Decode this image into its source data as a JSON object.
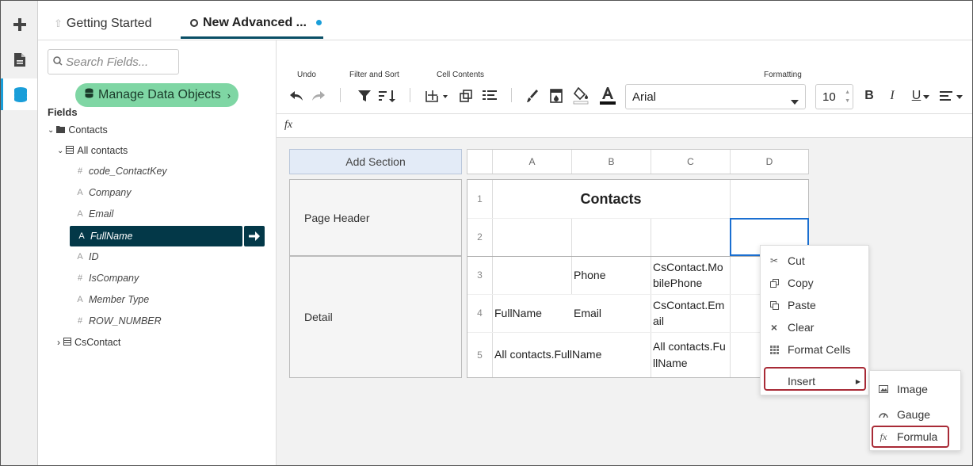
{
  "rail": {
    "icons": [
      "plus-icon",
      "document-icon",
      "database-icon"
    ]
  },
  "tabs": [
    {
      "label": "Getting Started",
      "icon": "home-icon"
    },
    {
      "label": "New Advanced ...",
      "icon": "circle-icon",
      "unsaved_dot": true
    }
  ],
  "left_panel": {
    "search_placeholder": "Search Fields...",
    "manage_button": "Manage Data Objects",
    "fields_label": "Fields",
    "tree": {
      "root": "Contacts",
      "group": "All contacts",
      "fields": [
        {
          "name": "code_ContactKey",
          "type": "#"
        },
        {
          "name": "Company",
          "type": "A"
        },
        {
          "name": "Email",
          "type": "A"
        },
        {
          "name": "FullName",
          "type": "A",
          "selected": true
        },
        {
          "name": "ID",
          "type": "A"
        },
        {
          "name": "IsCompany",
          "type": "#"
        },
        {
          "name": "Member Type",
          "type": "A"
        },
        {
          "name": "ROW_NUMBER",
          "type": "#"
        }
      ],
      "other": "CsContact"
    }
  },
  "toolbar": {
    "groups": {
      "undo": "Undo",
      "filter_sort": "Filter and Sort",
      "cell_contents": "Cell Contents",
      "formatting": "Formatting"
    },
    "font": "Arial",
    "font_size": "10",
    "bold": "B",
    "italic": "I",
    "underline": "U"
  },
  "formula_bar": {
    "fx": "fx"
  },
  "canvas": {
    "add_section": "Add Section",
    "sections": [
      "Page Header",
      "Detail"
    ],
    "columns": [
      "A",
      "B",
      "C",
      "D"
    ],
    "rows": [
      "1",
      "2",
      "3",
      "4",
      "5"
    ],
    "cells": {
      "title": "Contacts",
      "r3b": "Phone",
      "r3c": "CsContact.MobilePhone",
      "r4a": "FullName",
      "r4b": "Email",
      "r4c": "CsContact.Email",
      "r5a": "All contacts.FullName",
      "r5c": "All contacts.FullName"
    }
  },
  "context_menu": {
    "items": [
      {
        "label": "Cut",
        "icon": "scissors-icon"
      },
      {
        "label": "Copy",
        "icon": "copy-icon"
      },
      {
        "label": "Paste",
        "icon": "paste-icon"
      },
      {
        "label": "Clear",
        "icon": "clear-icon"
      },
      {
        "label": "Format Cells",
        "icon": "format-cells-icon"
      },
      {
        "label": "Insert",
        "icon": "",
        "submenu": true
      }
    ]
  },
  "submenu": {
    "items": [
      {
        "label": "Image",
        "icon": "image-icon"
      },
      {
        "label": "Gauge",
        "icon": "gauge-icon"
      },
      {
        "label": "Formula",
        "icon": "formula-icon"
      }
    ]
  },
  "colors": {
    "selected_row": "#033848",
    "accent_green": "#7fd6a4",
    "highlight_border": "#a82a36",
    "tab_underline": "#0a4f66",
    "unsaved_dot": "#1a9ed9"
  }
}
